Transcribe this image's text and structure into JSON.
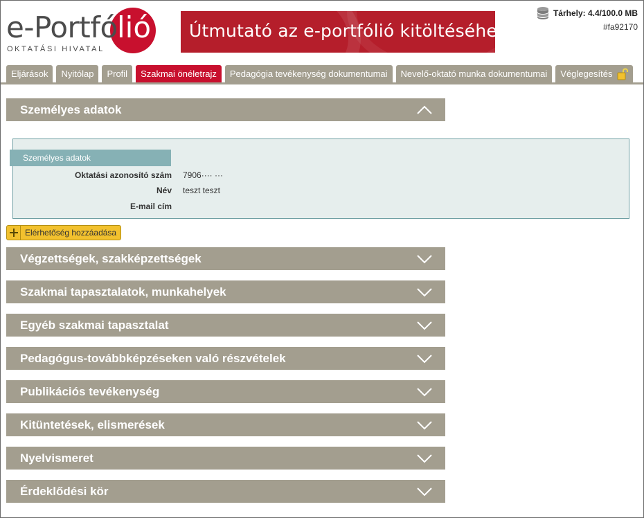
{
  "header": {
    "logo_main": "e-Portfó",
    "logo_accent": "lió",
    "logo_sub": "OKTATÁSI HIVATAL",
    "banner_text": "Útmutató az e-portfólió kitöltéséhez",
    "storage_label": "Tárhely: 4.4/100.0 MB",
    "storage_id": "#fa92170"
  },
  "tabs": [
    {
      "label": "Eljárások"
    },
    {
      "label": "Nyitólap"
    },
    {
      "label": "Profil"
    },
    {
      "label": "Szakmai önéletrajz"
    },
    {
      "label": "Pedagógia tevékenység dokumentumai"
    },
    {
      "label": "Nevelő-oktató munka dokumentumai"
    },
    {
      "label": "Véglegesítés"
    }
  ],
  "personal": {
    "title": "Személyes adatok",
    "panel_tab": "Személyes adatok",
    "fields": [
      {
        "label": "Oktatási azonosító szám",
        "value": "7906···· ···"
      },
      {
        "label": "Név",
        "value": "teszt teszt"
      },
      {
        "label": "E-mail cím",
        "value": ""
      }
    ],
    "add_button": "Elérhetőség hozzáadása"
  },
  "sections": [
    "Végzettségek, szakképzettségek",
    "Szakmai tapasztalatok, munkahelyek",
    "Egyéb szakmai tapasztalat",
    "Pedagógus-továbbképzéseken való részvételek",
    "Publikációs tevékenység",
    "Kitüntetések, elismerések",
    "Nyelvismeret",
    "Érdeklődési kör"
  ],
  "colors": {
    "brand_red": "#c8102e",
    "tab_gray": "#a39e8f",
    "panel_bg": "#e6eeed",
    "panel_tab": "#86b1b5",
    "button_yellow": "#f2c12e"
  }
}
